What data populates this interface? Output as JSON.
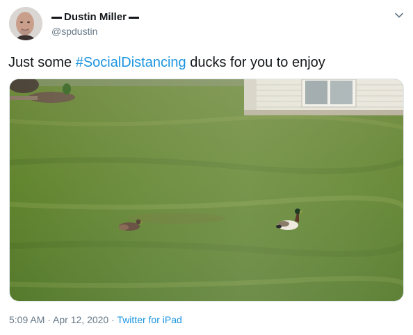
{
  "user": {
    "display_name": "Dustin Miller",
    "handle": "@spdustin"
  },
  "tweet": {
    "text_before": "Just some ",
    "hashtag": "#SocialDistancing",
    "text_after": " ducks for you to enjoy"
  },
  "meta": {
    "time": "5:09 AM",
    "separator1": " · ",
    "date": "Apr 12, 2020",
    "separator2": " · ",
    "source": "Twitter for iPad"
  },
  "icons": {
    "menu": "chevron-down-icon"
  },
  "colors": {
    "link": "#1b95e0",
    "secondary_text": "#657786",
    "primary_text": "#14171a"
  }
}
